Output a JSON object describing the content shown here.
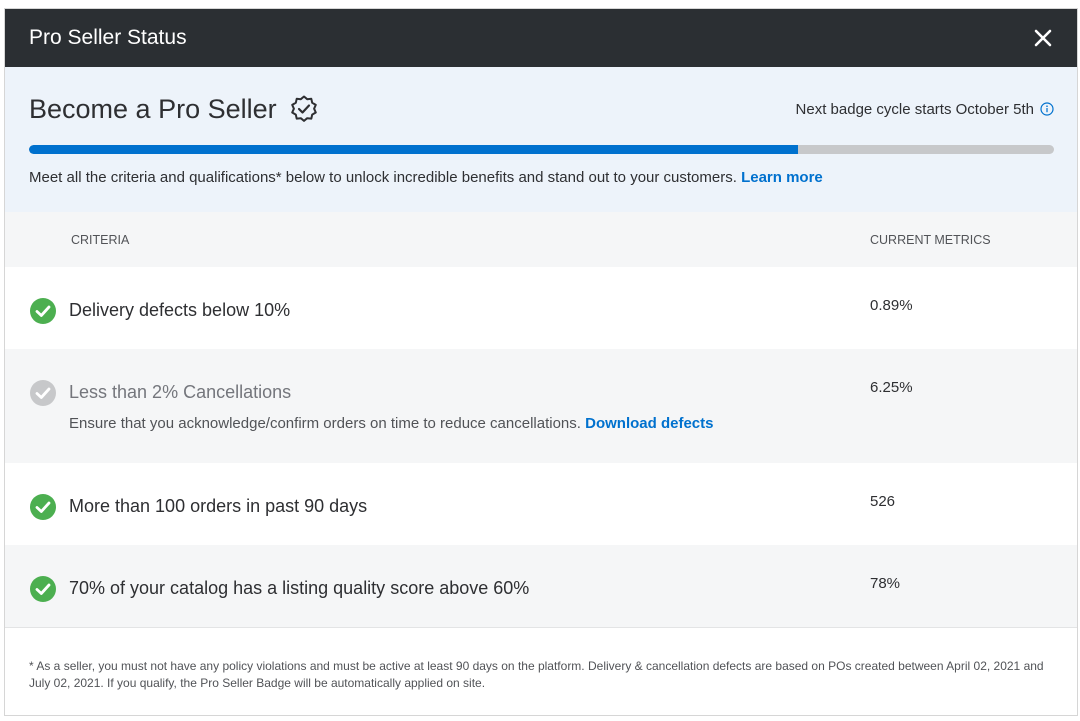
{
  "titlebar": {
    "title": "Pro Seller Status"
  },
  "hero": {
    "title": "Become a Pro Seller",
    "next_cycle": "Next badge cycle starts October 5th",
    "progress_fraction": 0.75,
    "description": "Meet all the criteria and qualifications* below to unlock incredible benefits and stand out to your customers.",
    "learn_more": "Learn more"
  },
  "columns": {
    "criteria": "CRITERIA",
    "metrics": "CURRENT METRICS"
  },
  "rows": [
    {
      "label": "Delivery defects below 10%",
      "metric": "0.89%",
      "status": "met"
    },
    {
      "label": "Less than 2% Cancellations",
      "metric": "6.25%",
      "status": "not-met",
      "detail": "Ensure that you acknowledge/confirm orders on time to reduce cancellations.",
      "link": "Download defects"
    },
    {
      "label": "More than 100 orders in past 90 days",
      "metric": "526",
      "status": "met"
    },
    {
      "label": "70% of your catalog has a listing quality score above 60%",
      "metric": "78%",
      "status": "met"
    }
  ],
  "footnote": "* As a seller, you must not have any policy violations and must be active at least 90 days on the platform. Delivery & cancellation defects are based on POs created between April 02, 2021 and July 02, 2021. If you qualify, the Pro Seller Badge will be automatically applied on site.",
  "colors": {
    "accent": "#0071ce",
    "success": "#2a8703",
    "check_green": "#4caf50",
    "disabled": "#c7c8ca",
    "titlebar": "#2b2f33"
  }
}
